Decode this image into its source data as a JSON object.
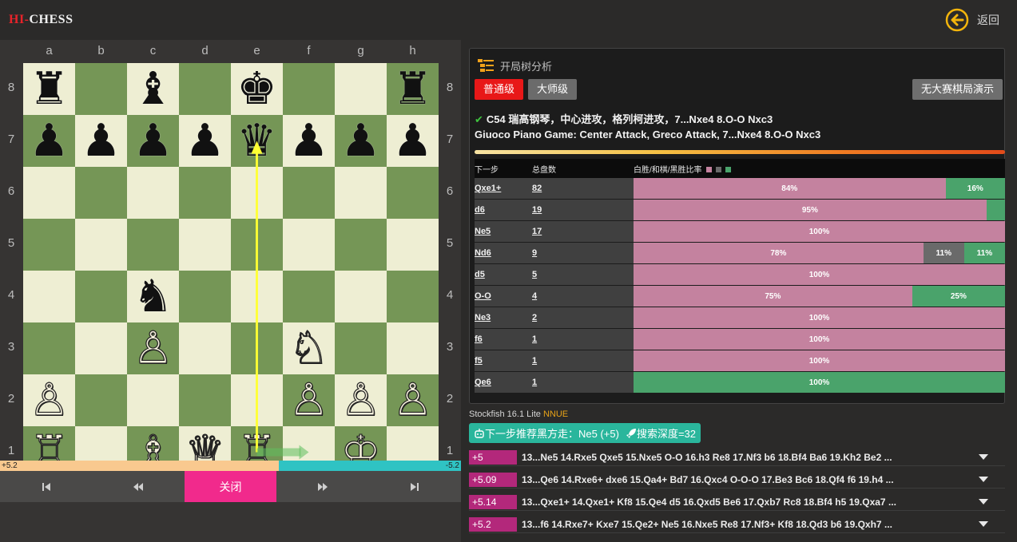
{
  "header": {
    "logo_hi": "HI-",
    "logo_rest": "CHESS",
    "back_label": "返回"
  },
  "board": {
    "files": [
      "a",
      "b",
      "c",
      "d",
      "e",
      "f",
      "g",
      "h"
    ],
    "ranks": [
      "8",
      "7",
      "6",
      "5",
      "4",
      "3",
      "2",
      "1"
    ],
    "pieces": [
      {
        "square": "a8",
        "glyph": "♜",
        "color": "black",
        "name": "black-rook-icon"
      },
      {
        "square": "c8",
        "glyph": "♝",
        "color": "black",
        "name": "black-bishop-icon"
      },
      {
        "square": "e8",
        "glyph": "♚",
        "color": "black",
        "name": "black-king-icon"
      },
      {
        "square": "h8",
        "glyph": "♜",
        "color": "black",
        "name": "black-rook-icon"
      },
      {
        "square": "a7",
        "glyph": "♟",
        "color": "black",
        "name": "black-pawn-icon"
      },
      {
        "square": "b7",
        "glyph": "♟",
        "color": "black",
        "name": "black-pawn-icon"
      },
      {
        "square": "c7",
        "glyph": "♟",
        "color": "black",
        "name": "black-pawn-icon"
      },
      {
        "square": "d7",
        "glyph": "♟",
        "color": "black",
        "name": "black-pawn-icon"
      },
      {
        "square": "e7",
        "glyph": "♛",
        "color": "black",
        "name": "black-queen-icon"
      },
      {
        "square": "f7",
        "glyph": "♟",
        "color": "black",
        "name": "black-pawn-icon"
      },
      {
        "square": "g7",
        "glyph": "♟",
        "color": "black",
        "name": "black-pawn-icon"
      },
      {
        "square": "h7",
        "glyph": "♟",
        "color": "black",
        "name": "black-pawn-icon"
      },
      {
        "square": "c4",
        "glyph": "♞",
        "color": "black",
        "name": "black-knight-icon"
      },
      {
        "square": "c3",
        "glyph": "♙",
        "color": "white",
        "name": "white-pawn-icon"
      },
      {
        "square": "f3",
        "glyph": "♘",
        "color": "white",
        "name": "white-knight-icon"
      },
      {
        "square": "a2",
        "glyph": "♙",
        "color": "white",
        "name": "white-pawn-icon"
      },
      {
        "square": "f2",
        "glyph": "♙",
        "color": "white",
        "name": "white-pawn-icon"
      },
      {
        "square": "g2",
        "glyph": "♙",
        "color": "white",
        "name": "white-pawn-icon"
      },
      {
        "square": "h2",
        "glyph": "♙",
        "color": "white",
        "name": "white-pawn-icon"
      },
      {
        "square": "a1",
        "glyph": "♖",
        "color": "white",
        "name": "white-rook-icon"
      },
      {
        "square": "c1",
        "glyph": "♗",
        "color": "white",
        "name": "white-bishop-icon"
      },
      {
        "square": "d1",
        "glyph": "♕",
        "color": "white",
        "name": "white-queen-icon"
      },
      {
        "square": "e1",
        "glyph": "♖",
        "color": "white",
        "name": "white-rook-icon"
      },
      {
        "square": "g1",
        "glyph": "♔",
        "color": "white",
        "name": "white-king-icon"
      }
    ],
    "arrows": [
      {
        "from": "e1",
        "to": "e7",
        "color": "#ffff33",
        "name": "best-move-arrow"
      },
      {
        "from": "e1",
        "to": "f1",
        "color": "#5fbf5f",
        "name": "last-move-arrow"
      }
    ]
  },
  "evalbar": {
    "white_label": "+5.2",
    "black_label": "-5.2",
    "white_fraction": 0.605
  },
  "controls": {
    "first": "⏮",
    "prev": "⏪",
    "close": "关闭",
    "next": "⏩",
    "last": "⏭"
  },
  "tree": {
    "title": "开局树分析",
    "btn_normal": "普通级",
    "btn_master": "大师级",
    "btn_nomaster": "无大赛棋局演示",
    "opening_cn": "C54 瑞高钢琴，中心进攻，格列柯进攻，7...Nxe4 8.O-O Nxc3",
    "opening_en": "Giuoco Piano Game: Center Attack, Greco Attack, 7...Nxe4 8.O-O Nxc3",
    "col_move": "下一步",
    "col_count": "总盘数",
    "col_ratio": "白胜/和棋/黑胜比率",
    "legend_colors": [
      "#c4829f",
      "#6a6a6a",
      "#4aa36b"
    ],
    "rows": [
      {
        "move": "Qxe1+",
        "count": "82",
        "w": 84,
        "d": 0,
        "b": 16,
        "wl": "84%",
        "dl": "",
        "bl": "16%"
      },
      {
        "move": "d6",
        "count": "19",
        "w": 95,
        "d": 0,
        "b": 5,
        "wl": "95%",
        "dl": "",
        "bl": ""
      },
      {
        "move": "Ne5",
        "count": "17",
        "w": 100,
        "d": 0,
        "b": 0,
        "wl": "100%",
        "dl": "",
        "bl": ""
      },
      {
        "move": "Nd6",
        "count": "9",
        "w": 78,
        "d": 11,
        "b": 11,
        "wl": "78%",
        "dl": "11%",
        "bl": "11%"
      },
      {
        "move": "d5",
        "count": "5",
        "w": 100,
        "d": 0,
        "b": 0,
        "wl": "100%",
        "dl": "",
        "bl": ""
      },
      {
        "move": "O-O",
        "count": "4",
        "w": 75,
        "d": 0,
        "b": 25,
        "wl": "75%",
        "dl": "",
        "bl": "25%"
      },
      {
        "move": "Ne3",
        "count": "2",
        "w": 100,
        "d": 0,
        "b": 0,
        "wl": "100%",
        "dl": "",
        "bl": ""
      },
      {
        "move": "f6",
        "count": "1",
        "w": 100,
        "d": 0,
        "b": 0,
        "wl": "100%",
        "dl": "",
        "bl": ""
      },
      {
        "move": "f5",
        "count": "1",
        "w": 100,
        "d": 0,
        "b": 0,
        "wl": "100%",
        "dl": "",
        "bl": ""
      },
      {
        "move": "Qe6",
        "count": "1",
        "w": 0,
        "d": 0,
        "b": 100,
        "wl": "",
        "dl": "",
        "bl": "100%"
      }
    ]
  },
  "engine": {
    "name": "Stockfish 16.1 Lite ",
    "nnue": "NNUE",
    "recommend": "下一步推荐黑方走：Ne5 (+5)",
    "depth": "搜索深度=32",
    "lines": [
      {
        "score": "+5",
        "pv": "13...Ne5 14.Rxe5 Qxe5 15.Nxe5 O-O 16.h3 Re8 17.Nf3 b6 18.Bf4 Ba6 19.Kh2 Be2 ..."
      },
      {
        "score": "+5.09",
        "pv": "13...Qe6 14.Rxe6+ dxe6 15.Qa4+ Bd7 16.Qxc4 O-O-O 17.Be3 Bc6 18.Qf4 f6 19.h4 ..."
      },
      {
        "score": "+5.14",
        "pv": "13...Qxe1+ 14.Qxe1+ Kf8 15.Qe4 d5 16.Qxd5 Be6 17.Qxb7 Rc8 18.Bf4 h5 19.Qxa7 ..."
      },
      {
        "score": "+5.2",
        "pv": "13...f6 14.Rxe7+ Kxe7 15.Qe2+ Ne5 16.Nxe5 Re8 17.Nf3+ Kf8 18.Qd3 b6 19.Qxh7 ..."
      }
    ]
  }
}
